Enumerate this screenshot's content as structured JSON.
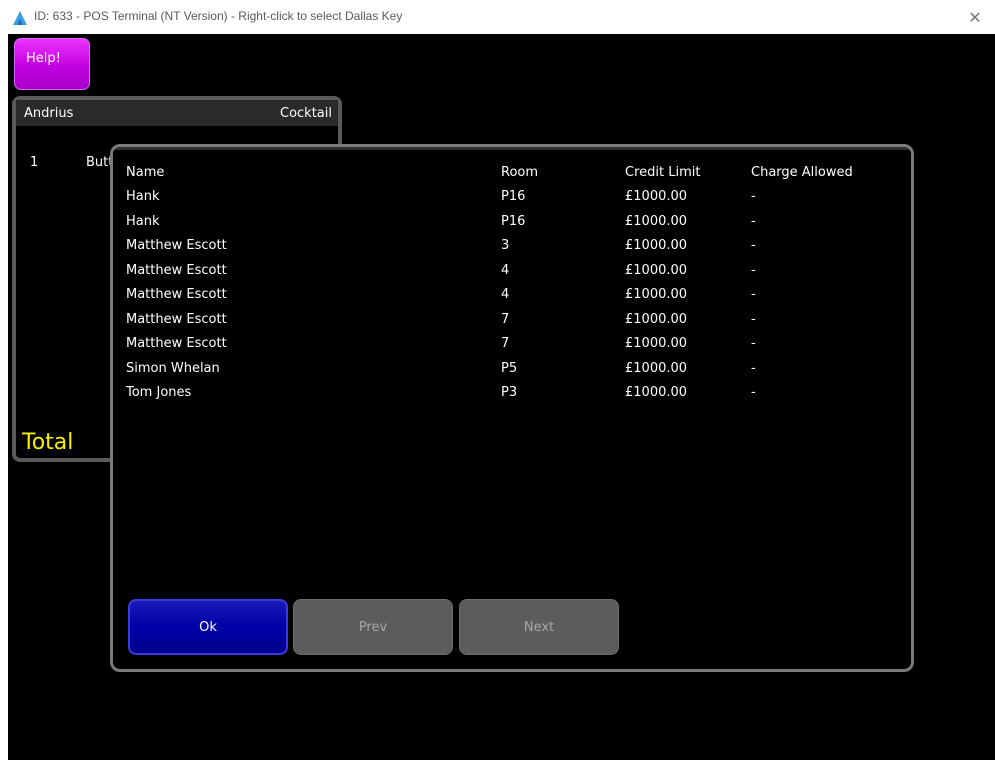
{
  "window": {
    "title": "ID: 633 - POS Terminal (NT Version) - Right-click to select Dallas Key",
    "close_glyph": "✕"
  },
  "colors": {
    "help_button": "#c000e0",
    "ok_button": "#0000a8",
    "disabled_button": "#5c5c5c",
    "total_text": "#f7ef00",
    "app_logo": "#3aa0e8"
  },
  "toolbar": {
    "help_label": "Help!"
  },
  "order": {
    "user": "Andrius",
    "mode": "Cocktail",
    "lines": [
      {
        "qty": "1",
        "name_visible": "Butt"
      }
    ],
    "total_label": "Total"
  },
  "dialog": {
    "columns": [
      "Name",
      "Room",
      "Credit Limit",
      "Charge Allowed"
    ],
    "rows": [
      [
        "Hank",
        "P16",
        "£1000.00",
        "-"
      ],
      [
        "Hank",
        "P16",
        "£1000.00",
        "-"
      ],
      [
        "Matthew Escott",
        "3",
        "£1000.00",
        "-"
      ],
      [
        "Matthew Escott",
        "4",
        "£1000.00",
        "-"
      ],
      [
        "Matthew Escott",
        "4",
        "£1000.00",
        "-"
      ],
      [
        "Matthew Escott",
        "7",
        "£1000.00",
        "-"
      ],
      [
        "Matthew Escott",
        "7",
        "£1000.00",
        "-"
      ],
      [
        "Simon Whelan",
        "P5",
        "£1000.00",
        "-"
      ],
      [
        "Tom Jones",
        "P3",
        "£1000.00",
        "-"
      ]
    ],
    "buttons": {
      "ok": "Ok",
      "prev": "Prev",
      "next": "Next"
    }
  }
}
